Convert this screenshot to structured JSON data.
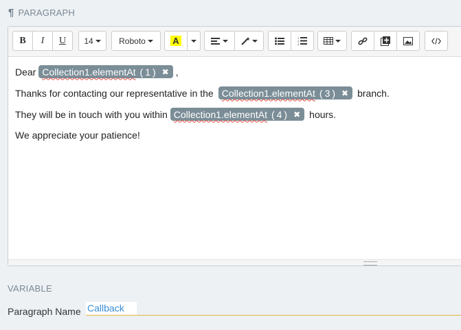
{
  "section": {
    "icon": "pilcrow-icon",
    "title": "PARAGRAPH"
  },
  "toolbar": {
    "bold_label": "B",
    "italic_label": "I",
    "underline_label": "U",
    "font_size": "14",
    "font_family": "Roboto",
    "highlight_label": "A",
    "highlight_color": "#ffff00",
    "icons": {
      "align": "align-left-icon",
      "magic": "magic-wand-icon",
      "ul": "bullet-list-icon",
      "ol": "numbered-list-icon",
      "table": "table-icon",
      "link": "link-icon",
      "add": "add-box-icon",
      "image": "image-icon",
      "code": "code-view-icon"
    }
  },
  "content": {
    "line1": {
      "before": "Dear",
      "chip_var": "Collection1.elementAt",
      "chip_idx": "(1)",
      "after": ","
    },
    "line2": {
      "before": "Thanks for contacting our representative in the",
      "chip_var": "Collection1.elementAt",
      "chip_idx": "(3)",
      "after": "branch."
    },
    "line3": {
      "before": "They will be in touch with you within",
      "chip_var": "Collection1.elementAt",
      "chip_idx": "(4)",
      "after": "hours."
    },
    "line4": {
      "text": "We appreciate your patience!"
    }
  },
  "variable": {
    "title": "VARIABLE",
    "paragraph_name_label": "Paragraph Name",
    "paragraph_name_value": "Callback"
  },
  "colors": {
    "chip_bg": "#7b8e97",
    "accent_underline": "#e3b63b",
    "input_text": "#3b8fd6"
  }
}
